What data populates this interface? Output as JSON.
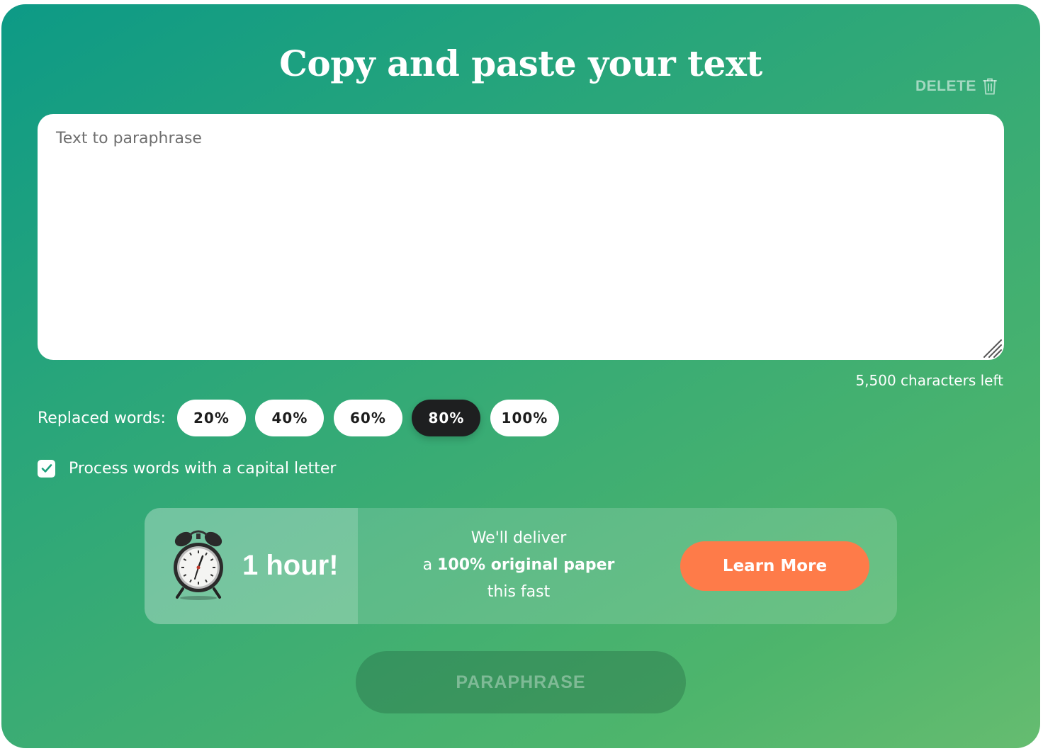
{
  "header": {
    "title": "Copy and paste your text",
    "delete_label": "DELETE"
  },
  "editor": {
    "placeholder": "Text to paraphrase",
    "value": "",
    "chars_left": "5,500 characters left"
  },
  "replaced_words": {
    "label": "Replaced words:",
    "options": [
      "20%",
      "40%",
      "60%",
      "80%",
      "100%"
    ],
    "selected": "80%"
  },
  "capital_option": {
    "label": "Process words with a capital letter",
    "checked": true
  },
  "promo": {
    "hour_label": "1 hour!",
    "line1": "We'll deliver",
    "line2_prefix": "a ",
    "line2_bold": "100% original paper",
    "line3": "this fast",
    "cta_label": "Learn More",
    "cta_color": "#fe7b49"
  },
  "action": {
    "paraphrase_label": "PARAPHRASE"
  },
  "icons": {
    "delete": "trash-icon",
    "checkbox": "checkmark-icon",
    "promo": "alarm-clock-icon",
    "resize": "resize-handle-icon"
  },
  "colors": {
    "gradient_start": "#0d9a86",
    "gradient_end": "#66bc70",
    "active_pill": "#1e1f20"
  }
}
